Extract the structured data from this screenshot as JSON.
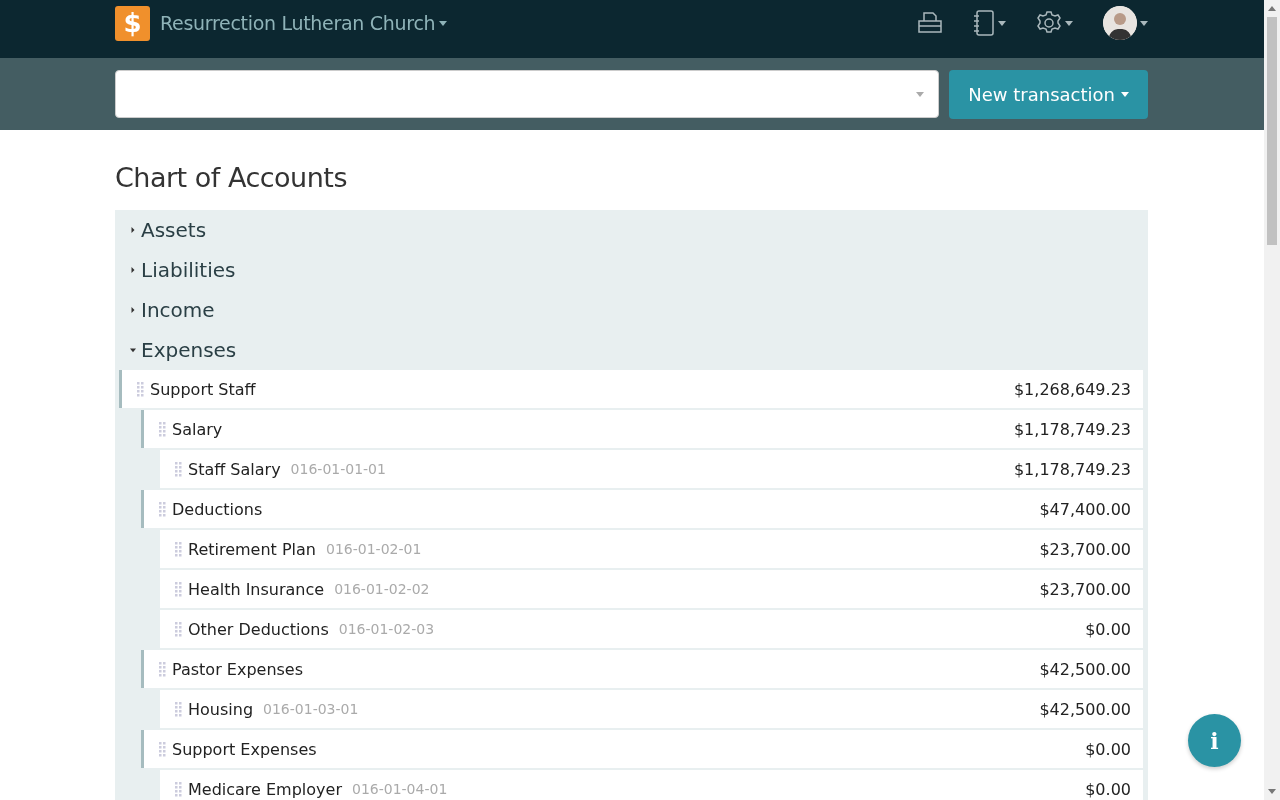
{
  "header": {
    "logo": "$",
    "organization": "Resurrection Lutheran Church"
  },
  "new_transaction": {
    "label": "New transaction"
  },
  "page_title": "Chart of Accounts",
  "categories": [
    {
      "name": "Assets",
      "expanded": false
    },
    {
      "name": "Liabilities",
      "expanded": false
    },
    {
      "name": "Income",
      "expanded": false
    },
    {
      "name": "Expenses",
      "expanded": true,
      "accounts": [
        {
          "name": "Support Staff",
          "amount": "$1,268,649.23",
          "children": [
            {
              "name": "Salary",
              "amount": "$1,178,749.23",
              "children": [
                {
                  "name": "Staff Salary",
                  "code": "016-01-01-01",
                  "amount": "$1,178,749.23"
                }
              ]
            },
            {
              "name": "Deductions",
              "amount": "$47,400.00",
              "children": [
                {
                  "name": "Retirement Plan",
                  "code": "016-01-02-01",
                  "amount": "$23,700.00"
                },
                {
                  "name": "Health Insurance",
                  "code": "016-01-02-02",
                  "amount": "$23,700.00"
                },
                {
                  "name": "Other Deductions",
                  "code": "016-01-02-03",
                  "amount": "$0.00"
                }
              ]
            },
            {
              "name": "Pastor Expenses",
              "amount": "$42,500.00",
              "children": [
                {
                  "name": "Housing",
                  "code": "016-01-03-01",
                  "amount": "$42,500.00"
                }
              ]
            },
            {
              "name": "Support Expenses",
              "amount": "$0.00",
              "children": [
                {
                  "name": "Medicare Employer",
                  "code": "016-01-04-01",
                  "amount": "$0.00"
                }
              ]
            }
          ]
        }
      ]
    }
  ],
  "info_button": {
    "label": "i"
  }
}
